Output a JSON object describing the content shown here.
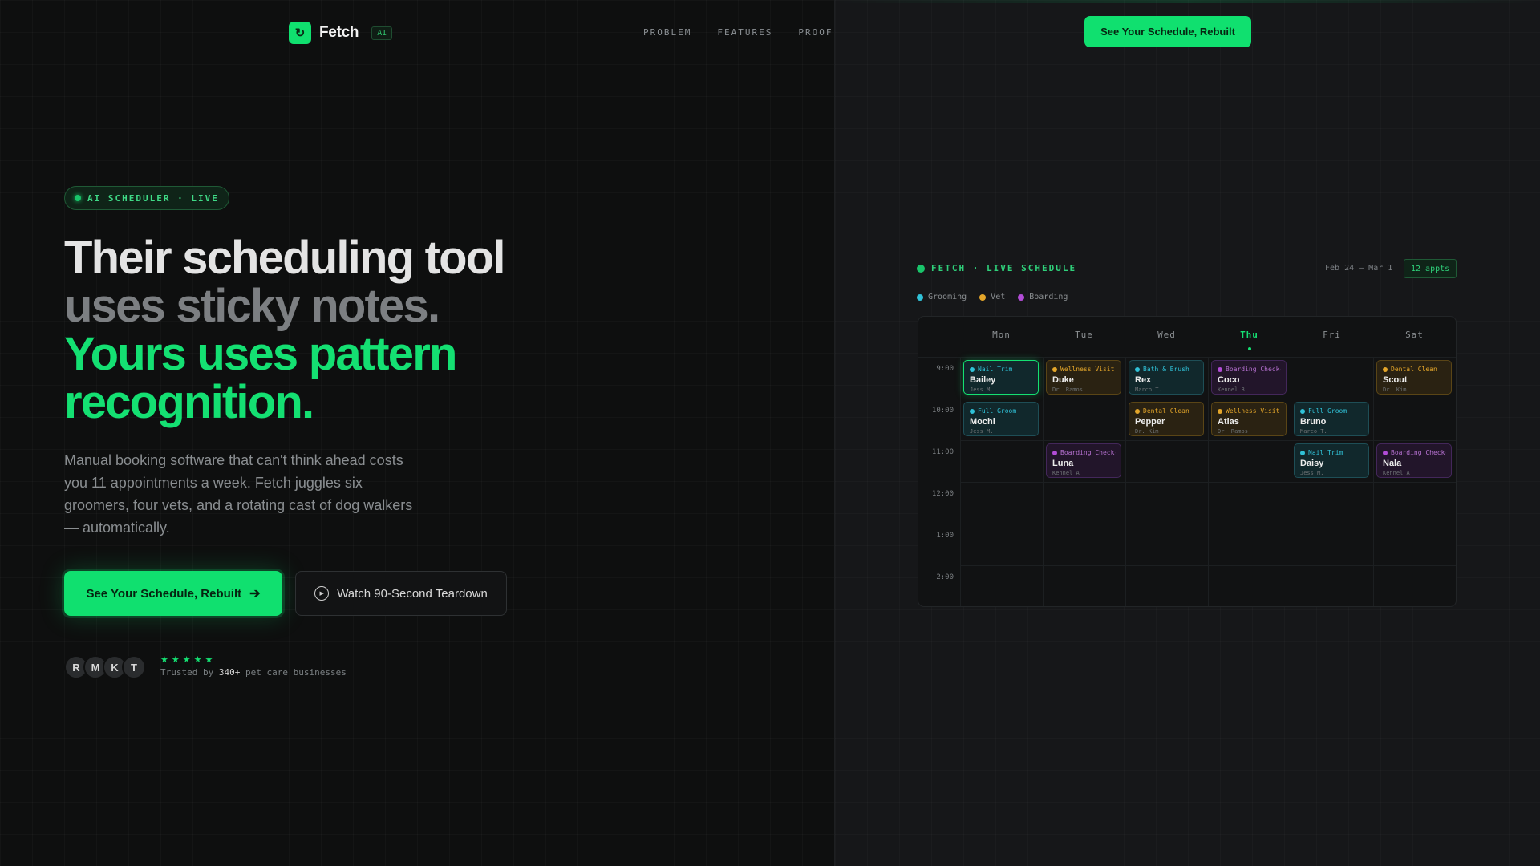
{
  "nav": {
    "brand": "Fetch",
    "badge": "AI",
    "links": [
      "PROBLEM",
      "FEATURES",
      "PROOF"
    ],
    "cta": "See Your Schedule, Rebuilt"
  },
  "hero": {
    "pill": "AI SCHEDULER · LIVE",
    "headline_1": "Their scheduling tool",
    "headline_2": "uses sticky notes.",
    "headline_3": "Yours uses pattern",
    "headline_4": "recognition.",
    "subcopy": "Manual booking software that can't think ahead costs you 11 appointments a week. Fetch juggles six groomers, four vets, and a rotating cast of dog walkers — automatically.",
    "primary_cta": "See Your Schedule, Rebuilt",
    "secondary_cta": "Watch 90-Second Teardown",
    "avatars": [
      "R",
      "M",
      "K",
      "T"
    ],
    "stars": "★★★★★",
    "trusted_prefix": "Trusted by",
    "trusted_count": "340+",
    "trusted_suffix": "pet care businesses"
  },
  "schedule": {
    "title": "FETCH · LIVE SCHEDULE",
    "range": "Feb 24 – Mar 1",
    "count": "12 appts",
    "legend": [
      {
        "label": "Grooming",
        "color": "#30c2d8"
      },
      {
        "label": "Vet",
        "color": "#e4a62a"
      },
      {
        "label": "Boarding",
        "color": "#b24cd6"
      }
    ],
    "days": [
      "Mon",
      "Tue",
      "Wed",
      "Thu",
      "Fri",
      "Sat"
    ],
    "today_index": 3,
    "times": [
      "9:00",
      "10:00",
      "11:00",
      "12:00",
      "1:00",
      "2:00"
    ],
    "appointments": [
      {
        "day": 0,
        "slot": 0,
        "kind": "groom",
        "service": "Nail Trim",
        "pet": "Bailey",
        "staff": "Jess M.",
        "highlight": true
      },
      {
        "day": 1,
        "slot": 0,
        "kind": "vet",
        "service": "Wellness Visit",
        "pet": "Duke",
        "staff": "Dr. Ramos"
      },
      {
        "day": 2,
        "slot": 0,
        "kind": "groom",
        "service": "Bath & Brush",
        "pet": "Rex",
        "staff": "Marco T."
      },
      {
        "day": 3,
        "slot": 0,
        "kind": "board",
        "service": "Boarding Check-in",
        "pet": "Coco",
        "staff": "Kennel B"
      },
      {
        "day": 5,
        "slot": 0,
        "kind": "vet",
        "service": "Dental Clean",
        "pet": "Scout",
        "staff": "Dr. Kim"
      },
      {
        "day": 0,
        "slot": 1,
        "kind": "groom",
        "service": "Full Groom",
        "pet": "Mochi",
        "staff": "Jess M."
      },
      {
        "day": 2,
        "slot": 1,
        "kind": "vet",
        "service": "Dental Clean",
        "pet": "Pepper",
        "staff": "Dr. Kim"
      },
      {
        "day": 3,
        "slot": 1,
        "kind": "vet",
        "service": "Wellness Visit",
        "pet": "Atlas",
        "staff": "Dr. Ramos"
      },
      {
        "day": 4,
        "slot": 1,
        "kind": "groom",
        "service": "Full Groom",
        "pet": "Bruno",
        "staff": "Marco T."
      },
      {
        "day": 1,
        "slot": 2,
        "kind": "board",
        "service": "Boarding Check-in",
        "pet": "Luna",
        "staff": "Kennel A"
      },
      {
        "day": 4,
        "slot": 2,
        "kind": "groom",
        "service": "Nail Trim",
        "pet": "Daisy",
        "staff": "Jess M."
      },
      {
        "day": 5,
        "slot": 2,
        "kind": "board",
        "service": "Boarding Check-in",
        "pet": "Nala",
        "staff": "Kennel A"
      }
    ]
  }
}
